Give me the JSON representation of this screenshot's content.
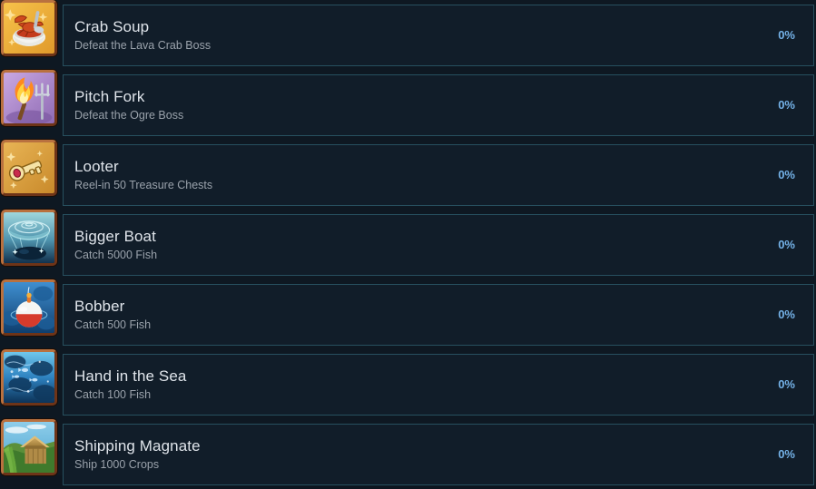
{
  "theme": {
    "page_bg": "#0e1822",
    "card_bg": "#111d29",
    "card_border": "#27505f",
    "title_color": "#dfe4ea",
    "desc_color": "#9aa2ab",
    "percent_color": "#74b2e8",
    "icon_frame_color": "#8a4a2a"
  },
  "achievements": [
    {
      "title": "Crab Soup",
      "description": "Defeat the Lava Crab Boss",
      "percent": "0%",
      "icon": "crab-soup-icon"
    },
    {
      "title": "Pitch Fork",
      "description": "Defeat the Ogre Boss",
      "percent": "0%",
      "icon": "pitch-fork-icon"
    },
    {
      "title": "Looter",
      "description": "Reel-in 50 Treasure Chests",
      "percent": "0%",
      "icon": "looter-icon"
    },
    {
      "title": "Bigger Boat",
      "description": "Catch 5000 Fish",
      "percent": "0%",
      "icon": "bigger-boat-icon"
    },
    {
      "title": "Bobber",
      "description": "Catch 500 Fish",
      "percent": "0%",
      "icon": "bobber-icon"
    },
    {
      "title": "Hand in the Sea",
      "description": "Catch 100 Fish",
      "percent": "0%",
      "icon": "hand-in-the-sea-icon"
    },
    {
      "title": "Shipping Magnate",
      "description": "Ship 1000 Crops",
      "percent": "0%",
      "icon": "shipping-magnate-icon"
    }
  ]
}
